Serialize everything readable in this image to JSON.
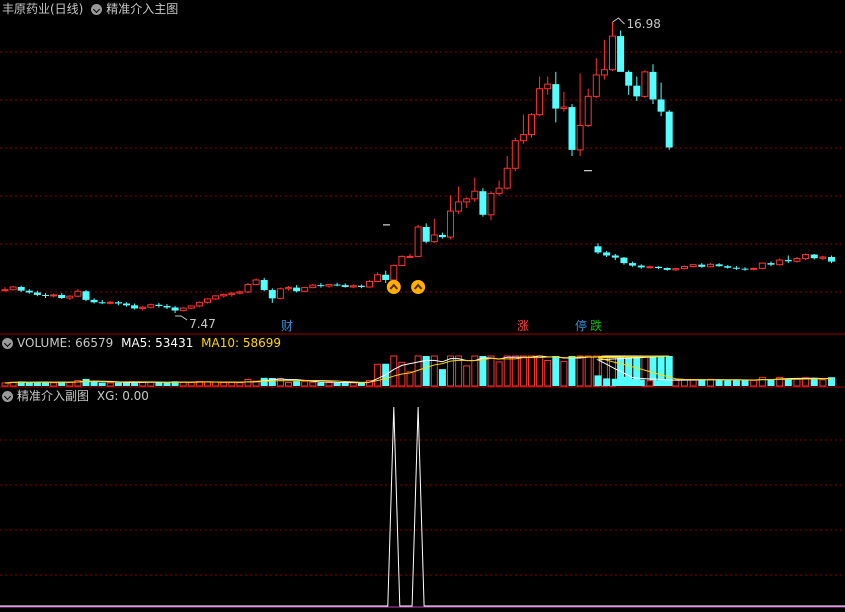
{
  "main_panel": {
    "stock_name": "丰原药业(日线)",
    "indicator_name": "精准介入主图",
    "high_label": "16.98",
    "low_label": "7.47",
    "event_tags": [
      {
        "text": "财",
        "color": "#3a8fd8"
      },
      {
        "text": "涨",
        "color": "#ff4040"
      },
      {
        "text": "停",
        "color": "#3a8fd8"
      },
      {
        "text": "跌",
        "color": "#00c000"
      }
    ]
  },
  "volume_panel": {
    "label_volume": "VOLUME: 66579",
    "label_ma5": "MA5: 53431",
    "label_ma10": "MA10: 58699",
    "ma5_color": "#ffffff",
    "ma10_color": "#ffd700"
  },
  "sub_panel": {
    "title": "精准介入副图",
    "xg_label": "XG: 0.00"
  },
  "colors": {
    "up": "#ff3232",
    "down": "#54ffff",
    "grid": "#8b0000",
    "text": "#c8c8c8",
    "signal": "#ffb000"
  },
  "chart_data": [
    {
      "type": "candlestick",
      "bars": 84,
      "price_range": [
        7.47,
        16.98
      ],
      "ohlc": [
        [
          8.23,
          8.31,
          8.18,
          8.23
        ],
        [
          8.23,
          8.35,
          8.2,
          8.32
        ],
        [
          8.32,
          8.36,
          8.16,
          8.2
        ],
        [
          8.2,
          8.25,
          8.1,
          8.14
        ],
        [
          8.14,
          8.2,
          8.02,
          8.06
        ],
        [
          8.06,
          8.12,
          7.96,
          8.03
        ],
        [
          8.03,
          8.1,
          7.98,
          8.06
        ],
        [
          8.06,
          8.12,
          7.93,
          7.96
        ],
        [
          7.96,
          8.05,
          7.9,
          8.02
        ],
        [
          8.02,
          8.25,
          7.98,
          8.18
        ],
        [
          8.18,
          8.22,
          7.86,
          7.9
        ],
        [
          7.9,
          7.95,
          7.78,
          7.82
        ],
        [
          7.82,
          7.9,
          7.76,
          7.8
        ],
        [
          7.8,
          7.86,
          7.75,
          7.82
        ],
        [
          7.82,
          7.86,
          7.72,
          7.78
        ],
        [
          7.78,
          7.82,
          7.68,
          7.72
        ],
        [
          7.72,
          7.78,
          7.58,
          7.62
        ],
        [
          7.62,
          7.7,
          7.55,
          7.66
        ],
        [
          7.66,
          7.78,
          7.62,
          7.74
        ],
        [
          7.74,
          7.8,
          7.65,
          7.7
        ],
        [
          7.7,
          7.76,
          7.6,
          7.65
        ],
        [
          7.65,
          7.7,
          7.47,
          7.55
        ],
        [
          7.55,
          7.66,
          7.52,
          7.63
        ],
        [
          7.63,
          7.72,
          7.6,
          7.7
        ],
        [
          7.7,
          7.85,
          7.66,
          7.82
        ],
        [
          7.82,
          7.95,
          7.78,
          7.93
        ],
        [
          7.93,
          8.05,
          7.9,
          8.03
        ],
        [
          8.03,
          8.1,
          7.98,
          8.08
        ],
        [
          8.08,
          8.15,
          8.0,
          8.12
        ],
        [
          8.12,
          8.2,
          8.08,
          8.16
        ],
        [
          8.16,
          8.45,
          8.12,
          8.4
        ],
        [
          8.4,
          8.6,
          8.38,
          8.55
        ],
        [
          8.55,
          8.62,
          8.18,
          8.22
        ],
        [
          8.22,
          8.28,
          7.8,
          7.95
        ],
        [
          7.95,
          8.3,
          7.92,
          8.26
        ],
        [
          8.26,
          8.35,
          8.2,
          8.3
        ],
        [
          8.3,
          8.38,
          8.14,
          8.18
        ],
        [
          8.18,
          8.32,
          8.15,
          8.3
        ],
        [
          8.3,
          8.42,
          8.28,
          8.38
        ],
        [
          8.38,
          8.45,
          8.3,
          8.35
        ],
        [
          8.35,
          8.42,
          8.3,
          8.4
        ],
        [
          8.4,
          8.46,
          8.34,
          8.38
        ],
        [
          8.38,
          8.44,
          8.3,
          8.32
        ],
        [
          8.32,
          8.4,
          8.28,
          8.36
        ],
        [
          8.36,
          8.4,
          8.28,
          8.32
        ],
        [
          8.32,
          8.55,
          8.3,
          8.5
        ],
        [
          8.5,
          8.8,
          8.48,
          8.72
        ],
        [
          8.72,
          8.85,
          8.45,
          8.55
        ],
        [
          8.55,
          9.05,
          8.52,
          9.02
        ],
        [
          9.02,
          9.35,
          9.0,
          9.32
        ],
        [
          9.32,
          9.4,
          9.28,
          9.32
        ],
        [
          9.32,
          10.35,
          9.3,
          10.28
        ],
        [
          10.28,
          10.4,
          9.75,
          9.8
        ],
        [
          9.8,
          10.55,
          9.76,
          10.02
        ],
        [
          10.02,
          10.1,
          9.9,
          9.95
        ],
        [
          9.95,
          11.32,
          9.88,
          10.8
        ],
        [
          10.8,
          11.6,
          10.7,
          11.1
        ],
        [
          11.1,
          11.25,
          10.9,
          11.2
        ],
        [
          11.2,
          11.9,
          11.1,
          11.45
        ],
        [
          11.45,
          11.55,
          10.62,
          10.68
        ],
        [
          10.68,
          11.45,
          10.5,
          11.38
        ],
        [
          11.38,
          11.8,
          11.3,
          11.55
        ],
        [
          11.55,
          12.6,
          11.5,
          12.2
        ],
        [
          12.2,
          13.2,
          12.1,
          13.1
        ],
        [
          13.1,
          13.95,
          13.0,
          13.3
        ],
        [
          13.3,
          14.0,
          13.2,
          13.95
        ],
        [
          13.95,
          15.2,
          13.9,
          14.8
        ],
        [
          14.8,
          15.2,
          14.6,
          14.95
        ],
        [
          14.95,
          15.35,
          13.7,
          14.15
        ],
        [
          14.15,
          14.7,
          14.05,
          14.2
        ],
        [
          14.2,
          14.3,
          12.6,
          12.8
        ],
        [
          12.8,
          15.3,
          12.6,
          13.6
        ],
        [
          13.6,
          14.8,
          13.55,
          14.55
        ],
        [
          14.55,
          15.8,
          14.5,
          15.25
        ],
        [
          15.25,
          16.4,
          15.1,
          15.42
        ],
        [
          15.42,
          16.98,
          15.38,
          16.52
        ],
        [
          16.52,
          16.7,
          15.4,
          15.35
        ],
        [
          15.35,
          15.4,
          14.6,
          14.9
        ],
        [
          14.9,
          15.2,
          14.4,
          14.55
        ],
        [
          14.55,
          15.4,
          14.5,
          15.35
        ],
        [
          15.35,
          15.6,
          14.3,
          14.45
        ],
        [
          14.45,
          15.0,
          13.9,
          14.05
        ],
        [
          14.05,
          14.1,
          12.8,
          12.88
        ],
        [
          12.88,
          12.9,
          12.8,
          12.88
        ]
      ],
      "gap_levels": [
        12.12,
        10.35
      ],
      "post_gap": [
        [
          9.65,
          9.75,
          9.4,
          9.45
        ],
        [
          9.45,
          9.5,
          9.3,
          9.35
        ],
        [
          9.35,
          9.4,
          9.2,
          9.28
        ],
        [
          9.28,
          9.3,
          9.05,
          9.1
        ],
        [
          9.1,
          9.15,
          8.98,
          9.02
        ],
        [
          9.02,
          9.06,
          8.92,
          8.96
        ],
        [
          8.96,
          9.02,
          8.93,
          8.98
        ],
        [
          8.98,
          9.0,
          8.9,
          8.94
        ],
        [
          8.94,
          8.96,
          8.85,
          8.88
        ],
        [
          8.88,
          8.95,
          8.84,
          8.92
        ],
        [
          8.92,
          9.02,
          8.9,
          8.99
        ],
        [
          8.99,
          9.06,
          8.96,
          9.05
        ],
        [
          9.05,
          9.1,
          8.95,
          8.98
        ],
        [
          8.98,
          9.1,
          8.96,
          9.06
        ],
        [
          9.06,
          9.1,
          8.98,
          9.0
        ],
        [
          9.0,
          9.04,
          8.92,
          8.95
        ],
        [
          8.95,
          9.0,
          8.88,
          8.92
        ],
        [
          8.92,
          8.96,
          8.85,
          8.9
        ],
        [
          8.9,
          8.96,
          8.86,
          8.93
        ],
        [
          8.93,
          9.12,
          8.9,
          9.1
        ],
        [
          9.1,
          9.15,
          9.0,
          9.05
        ],
        [
          9.05,
          9.25,
          9.02,
          9.2
        ],
        [
          9.2,
          9.35,
          9.1,
          9.16
        ],
        [
          9.16,
          9.3,
          9.12,
          9.25
        ],
        [
          9.25,
          9.42,
          9.2,
          9.38
        ],
        [
          9.38,
          9.4,
          9.22,
          9.26
        ],
        [
          9.26,
          9.34,
          9.2,
          9.3
        ],
        [
          9.3,
          9.35,
          9.1,
          9.15
        ]
      ],
      "signals_at_bars": [
        48,
        51
      ]
    },
    {
      "type": "bar",
      "name": "VOLUME",
      "last": 66579,
      "ma5_last": 53431,
      "ma10_last": 58699
    },
    {
      "type": "line",
      "name": "XG",
      "last": 0.0,
      "spikes_at_bars": [
        48,
        51
      ]
    }
  ]
}
